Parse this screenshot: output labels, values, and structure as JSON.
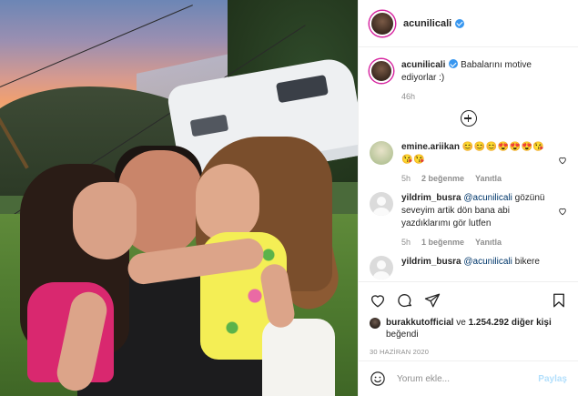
{
  "header": {
    "username": "acunilicali"
  },
  "caption": {
    "username": "acunilicali",
    "text": "Babalarını motive ediyorlar :)",
    "time": "46h"
  },
  "comments": [
    {
      "username": "emine.ariikan",
      "text": "😊😊😊😍😍😍😘😘😘",
      "time": "5h",
      "likes": "2 beğenme",
      "reply": "Yanıtla"
    },
    {
      "username": "yildrim_busra",
      "mention": "@acunilicali",
      "text": "gözünü seveyim artik dön bana abi yazdıklarımı gör lutfen",
      "time": "5h",
      "likes": "1 beğenme",
      "reply": "Yanıtla"
    },
    {
      "username": "yildrim_busra",
      "mention": "@acunilicali",
      "text": "bikere"
    }
  ],
  "likes": {
    "user": "burakkutofficial",
    "connector": "ve",
    "others": "1.254.292 diğer kişi",
    "suffix": "beğendi"
  },
  "date": "30 HAZİRAN 2020",
  "add_comment": {
    "placeholder": "Yorum ekle...",
    "post_label": "Paylaş"
  },
  "icons": {
    "verified": "verified-badge-icon",
    "more_comments": "plus-circle-icon",
    "like": "heart-icon",
    "comment": "comment-bubble-icon",
    "share": "paper-plane-icon",
    "save": "bookmark-icon",
    "emoji": "smiley-icon"
  },
  "colors": {
    "verified": "#3897f0",
    "link": "#00376b",
    "muted": "#8e8e8e",
    "post_disabled": "#b2dffc"
  }
}
